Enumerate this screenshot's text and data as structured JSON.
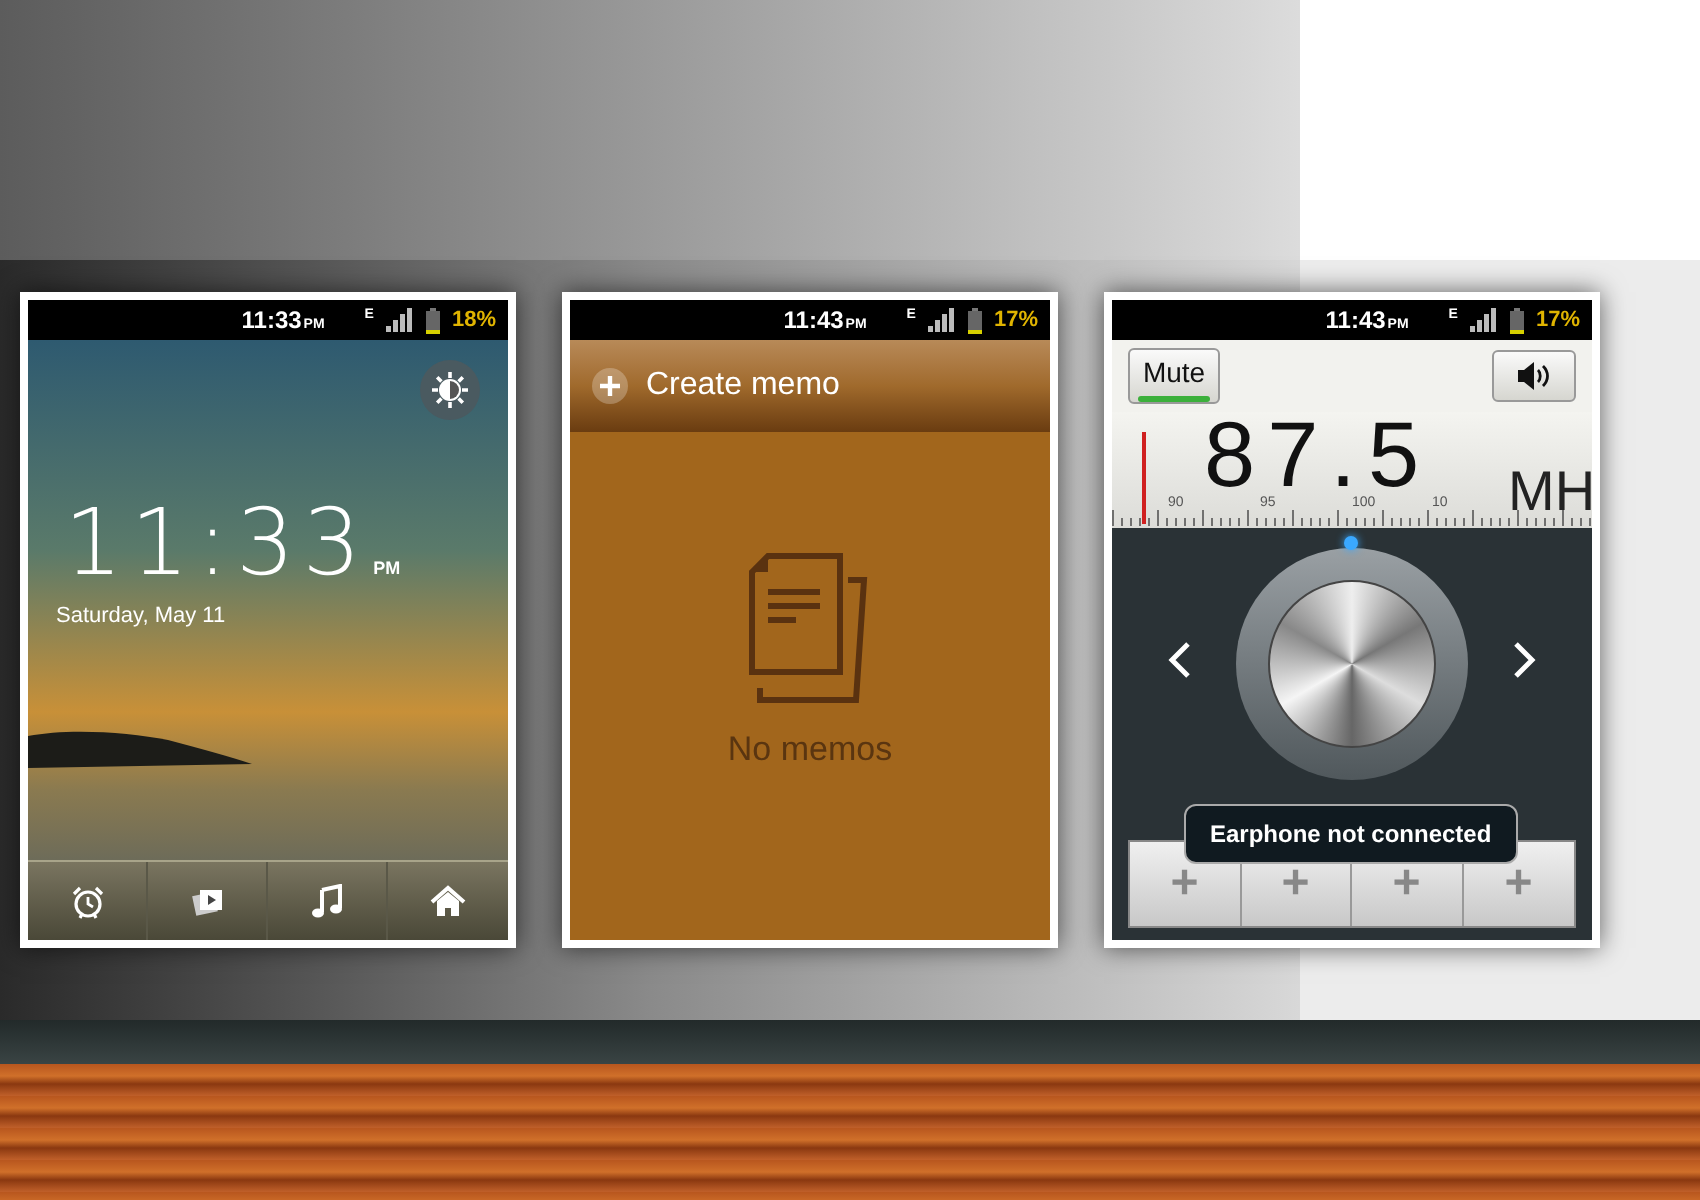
{
  "phones": [
    {
      "kind": "lockscreen",
      "status": {
        "time": "11:33",
        "ampm": "PM",
        "network": "E",
        "battery": "18%"
      },
      "clock": {
        "time": "11:33",
        "ampm": "PM",
        "date": "Saturday, May 11"
      }
    },
    {
      "kind": "memo",
      "status": {
        "time": "11:43",
        "ampm": "PM",
        "network": "E",
        "battery": "17%"
      },
      "header": {
        "label": "Create memo"
      },
      "empty": {
        "label": "No memos"
      }
    },
    {
      "kind": "radio",
      "status": {
        "time": "11:43",
        "ampm": "PM",
        "network": "E",
        "battery": "17%"
      },
      "mute": {
        "label": "Mute",
        "on": true
      },
      "frequency": "87.5",
      "unit": "MH",
      "scale_labels": [
        "90",
        "95",
        "100",
        "10"
      ],
      "toast": "Earphone not connected",
      "presets": [
        "+",
        "+",
        "+",
        "+"
      ]
    }
  ]
}
